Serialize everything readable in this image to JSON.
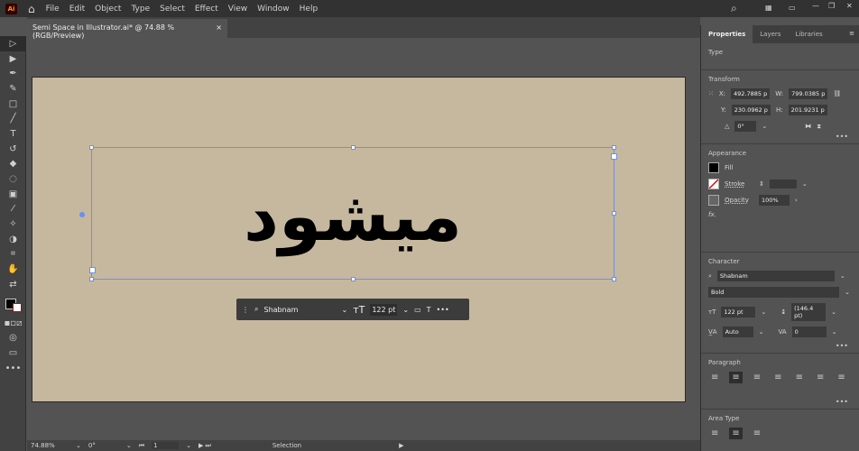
{
  "app": {
    "logo": "Ai",
    "menu": [
      "File",
      "Edit",
      "Object",
      "Type",
      "Select",
      "Effect",
      "View",
      "Window",
      "Help"
    ]
  },
  "document": {
    "tab_title": "Semi Space in Illustrator.ai* @ 74.88 % (RGB/Preview)",
    "close": "×"
  },
  "canvas": {
    "text": "میشود",
    "artboard_color": "#c6b89f",
    "selection_color": "#6b8ff0"
  },
  "context_bar": {
    "font": "Shabnam",
    "size": "122 pt",
    "more": "•••"
  },
  "status": {
    "zoom": "74.88%",
    "rotation": "0°",
    "artboard": "1",
    "tool": "Selection"
  },
  "panel": {
    "tabs": [
      "Properties",
      "Layers",
      "Libraries"
    ],
    "type_label": "Type",
    "transform": {
      "title": "Transform",
      "x_label": "X:",
      "x": "492.7885 p",
      "y_label": "Y:",
      "y": "230.0962 p",
      "w_label": "W:",
      "w": "799.0385 p",
      "h_label": "H:",
      "h": "201.9231 p",
      "angle": "0°"
    },
    "appearance": {
      "title": "Appearance",
      "fill": "Fill",
      "stroke": "Stroke",
      "opacity_label": "Opacity",
      "opacity": "100%",
      "fx": "fx."
    },
    "character": {
      "title": "Character",
      "font": "Shabnam",
      "style": "Bold",
      "size": "122 pt",
      "leading": "(146.4 pt)",
      "kerning": "Auto",
      "tracking": "0"
    },
    "paragraph": {
      "title": "Paragraph"
    },
    "area_type": {
      "title": "Area Type"
    },
    "more": "•••"
  }
}
